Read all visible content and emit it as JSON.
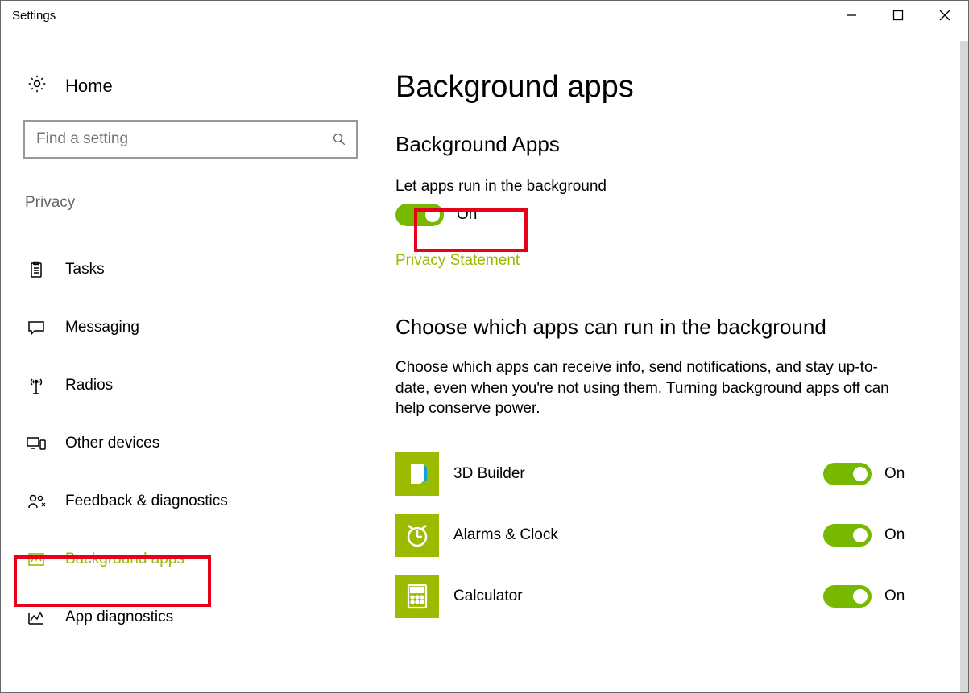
{
  "window": {
    "title": "Settings"
  },
  "colors": {
    "accent": "#99b900",
    "toggle": "#76b900",
    "highlight": "#e6001a"
  },
  "sidebar": {
    "home_label": "Home",
    "search_placeholder": "Find a setting",
    "category": "Privacy",
    "items": [
      {
        "id": "tasks",
        "label": "Tasks",
        "icon": "clipboard-icon"
      },
      {
        "id": "messaging",
        "label": "Messaging",
        "icon": "message-icon"
      },
      {
        "id": "radios",
        "label": "Radios",
        "icon": "radio-tower-icon"
      },
      {
        "id": "other-devices",
        "label": "Other devices",
        "icon": "devices-icon"
      },
      {
        "id": "feedback",
        "label": "Feedback & diagnostics",
        "icon": "feedback-icon"
      },
      {
        "id": "background-apps",
        "label": "Background apps",
        "icon": "background-apps-icon",
        "active": true,
        "highlighted": true
      },
      {
        "id": "app-diagnostics",
        "label": "App diagnostics",
        "icon": "diagnostics-icon"
      }
    ]
  },
  "main": {
    "page_title": "Background apps",
    "section1_title": "Background Apps",
    "master_label": "Let apps run in the background",
    "master_state_label": "On",
    "master_state": true,
    "master_highlighted": true,
    "privacy_link": "Privacy Statement",
    "section2_title": "Choose which apps can run in the background",
    "description": "Choose which apps can receive info, send notifications, and stay up-to-date, even when you're not using them. Turning background apps off can help conserve power.",
    "apps": [
      {
        "name": "3D Builder",
        "state_label": "On",
        "icon": "app-3d-builder-icon"
      },
      {
        "name": "Alarms & Clock",
        "state_label": "On",
        "icon": "app-alarms-icon"
      },
      {
        "name": "Calculator",
        "state_label": "On",
        "icon": "app-calculator-icon"
      }
    ]
  }
}
